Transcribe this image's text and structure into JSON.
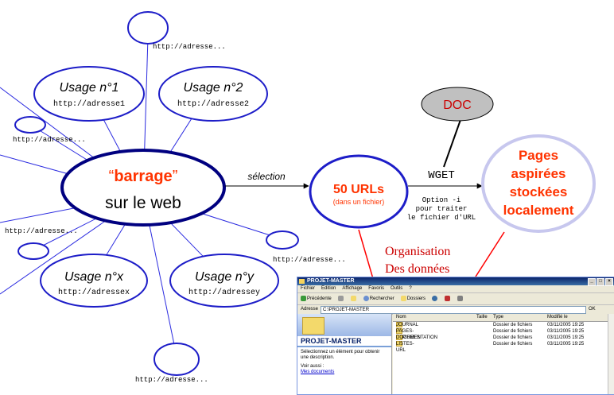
{
  "diagram": {
    "center": {
      "quote_open": "“",
      "word": "barrage",
      "quote_close": "”",
      "line2": "sur le web"
    },
    "usage1": {
      "title": "Usage n°1",
      "url": "http://adresse1"
    },
    "usage2": {
      "title": "Usage n°2",
      "url": "http://adresse2"
    },
    "usagex": {
      "title": "Usage n°x",
      "url": "http://adressex"
    },
    "usagey": {
      "title": "Usage n°y",
      "url": "http://adressey"
    },
    "small_labels": [
      "http://adresse...",
      "http://adresse...",
      "http://adresse...",
      "http://adresse...",
      "http://adresse..."
    ],
    "selection_label": "sélection",
    "urls": {
      "title": "50 URLs",
      "subtitle": "(dans un fichier)"
    },
    "wget_label": "WGET",
    "wget_option": [
      "Option -i",
      "pour traiter",
      "le fichier d'URL"
    ],
    "doc_label": "DOC",
    "pages": {
      "lines": [
        "Pages",
        "aspirées",
        "stockées",
        "localement"
      ]
    },
    "organisation": [
      "Organisation",
      "Des données"
    ],
    "colors": {
      "dark_blue": "#000080",
      "mid_blue": "#0000ff",
      "red_text": "#ff3300",
      "org_red": "#cc0000",
      "doc_gray": "#c0c0c0"
    }
  },
  "explorer": {
    "title": "PROJET-MASTER",
    "window_buttons": [
      "_",
      "□",
      "×"
    ],
    "menu": [
      "Fichier",
      "Edition",
      "Affichage",
      "Favoris",
      "Outils",
      "?"
    ],
    "toolbar": {
      "back": "Précédente",
      "search": "Rechercher",
      "folders": "Dossiers"
    },
    "address_label": "Adresse",
    "address_value": "C:\\PROJET-MASTER",
    "go_label": "OK",
    "left_panel": {
      "title": "PROJET-MASTER",
      "description": "Sélectionnez un élément pour obtenir une description.",
      "see_also": "Voir aussi :",
      "link": "Mes documents"
    },
    "columns": [
      "Nom",
      "Taille",
      "Type",
      "Modifié le"
    ],
    "files": [
      {
        "name": "JOURNAL",
        "type": "Dossier de fichiers",
        "date": "03/11/2005 19:25"
      },
      {
        "name": "PAGES-ASPIREES",
        "type": "Dossier de fichiers",
        "date": "03/11/2005 19:25"
      },
      {
        "name": "DOCUMENTATION",
        "type": "Dossier de fichiers",
        "date": "03/11/2005 19:25"
      },
      {
        "name": "LISTES-URL",
        "type": "Dossier de fichiers",
        "date": "03/11/2005 19:25"
      }
    ]
  }
}
